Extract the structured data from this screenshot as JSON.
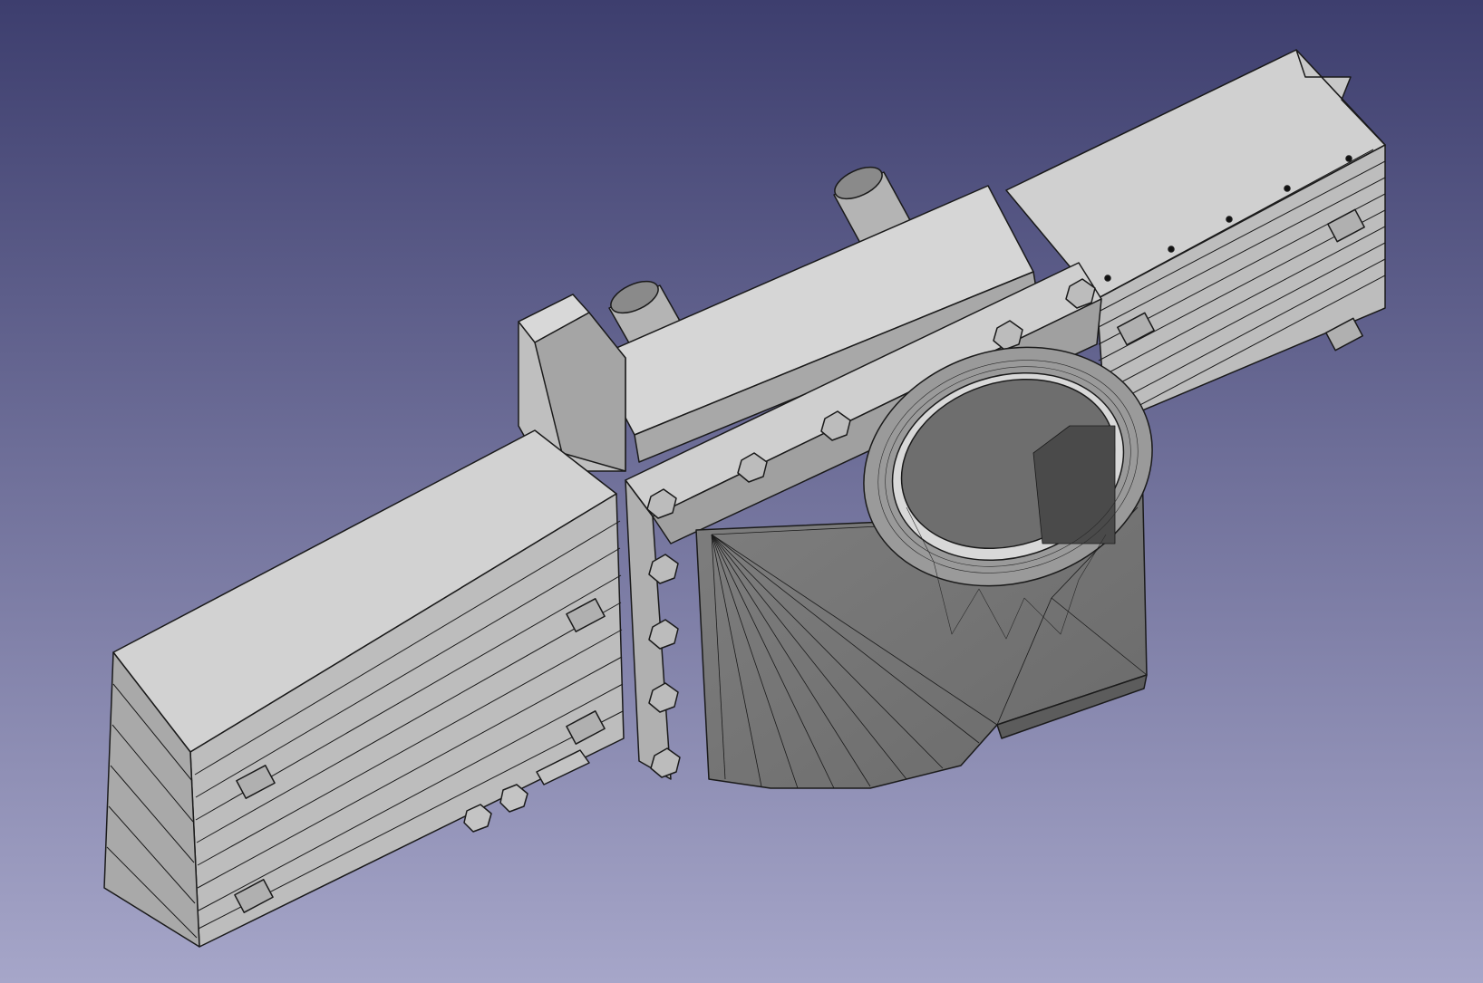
{
  "viewport": {
    "background_top": "#3d3e6e",
    "background_bottom": "#a6a6c9"
  },
  "model": {
    "fill_light": "#d2d2d2",
    "fill_mid": "#b9b9b9",
    "fill_dark": "#8e8e8e",
    "edge": "#1a1a1a"
  }
}
